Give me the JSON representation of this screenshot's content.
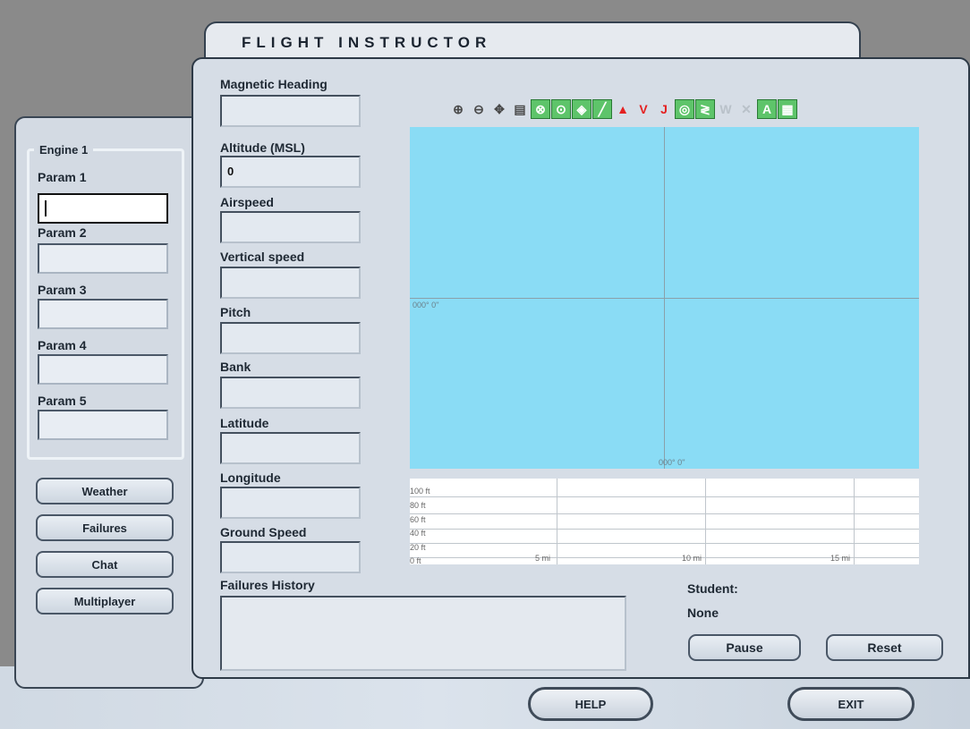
{
  "title": "FLIGHT INSTRUCTOR",
  "engine": {
    "group_label": "Engine 1",
    "params": [
      {
        "label": "Param 1",
        "value": ""
      },
      {
        "label": "Param 2",
        "value": ""
      },
      {
        "label": "Param 3",
        "value": ""
      },
      {
        "label": "Param 4",
        "value": ""
      },
      {
        "label": "Param 5",
        "value": ""
      }
    ]
  },
  "side_buttons": [
    "Weather",
    "Failures",
    "Chat",
    "Multiplayer"
  ],
  "fields": [
    {
      "label": "Magnetic Heading",
      "value": ""
    },
    {
      "label": "Altitude (MSL)",
      "value": "0"
    },
    {
      "label": "Airspeed",
      "value": ""
    },
    {
      "label": "Vertical speed",
      "value": ""
    },
    {
      "label": "Pitch",
      "value": ""
    },
    {
      "label": "Bank",
      "value": ""
    },
    {
      "label": "Latitude",
      "value": ""
    },
    {
      "label": "Longitude",
      "value": ""
    },
    {
      "label": "Ground Speed",
      "value": ""
    }
  ],
  "toolbar": {
    "icons": [
      "zoom-in-icon",
      "zoom-out-icon",
      "center-icon",
      "print-icon",
      "vor-icon",
      "ndb-icon",
      "ils-icon",
      "airway-icon",
      "airport-icon",
      "v-icon",
      "j-icon",
      "terrain-icon",
      "route-icon",
      "w-icon",
      "x-icon",
      "labels-icon",
      "map-icon"
    ],
    "text_icons": {
      "v": "V",
      "j": "J",
      "w": "W"
    }
  },
  "map": {
    "center_label_left": "000° 0''",
    "center_label_bottom": "000° 0''",
    "background": "#8adcf5"
  },
  "profile": {
    "y_labels": [
      "100 ft",
      "80 ft",
      "60 ft",
      "40 ft",
      "20 ft",
      "0 ft"
    ],
    "x_labels": [
      "5 mi",
      "10 mi",
      "15 mi"
    ]
  },
  "failures_history": {
    "label": "Failures History",
    "content": ""
  },
  "student": {
    "label": "Student:",
    "value": "None"
  },
  "buttons": {
    "pause": "Pause",
    "reset": "Reset",
    "help": "HELP",
    "exit": "EXIT"
  }
}
